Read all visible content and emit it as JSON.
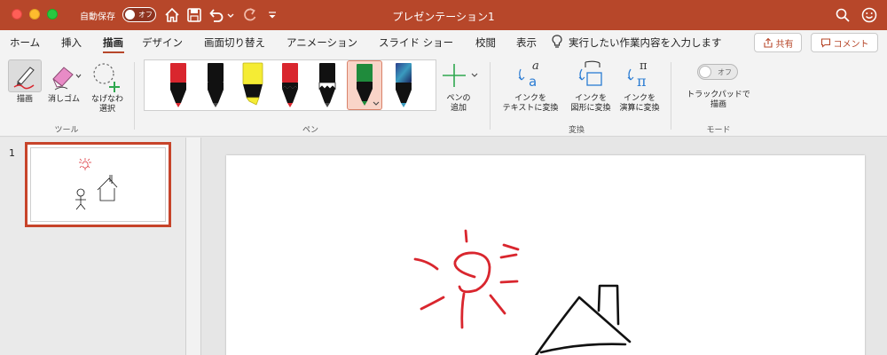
{
  "titlebar": {
    "autosave_label": "自動保存",
    "autosave_toggle_text": "オフ",
    "title": "プレゼンテーション1"
  },
  "menu": {
    "tabs": [
      "ホーム",
      "挿入",
      "描画",
      "デザイン",
      "画面切り替え",
      "アニメーション",
      "スライド ショー",
      "校閲",
      "表示"
    ],
    "active_tab": "描画",
    "tell_me": "実行したい作業内容を入力します",
    "share": "共有",
    "comment": "コメント"
  },
  "ribbon": {
    "tools_group": {
      "label": "ツール",
      "draw": "描画",
      "eraser": "消しゴム",
      "lasso_line1": "なげなわ",
      "lasso_line2": "選択"
    },
    "pens_group": {
      "label": "ペン",
      "pens": [
        {
          "name": "red-pen",
          "color": "#d9262e"
        },
        {
          "name": "black-pen",
          "color": "#111111"
        },
        {
          "name": "yellow-highlighter",
          "color": "#f5ec34"
        },
        {
          "name": "red-pencil",
          "color": "#d9262e"
        },
        {
          "name": "black-pencil",
          "color": "#111111"
        },
        {
          "name": "green-pen",
          "color": "#1f8b3c"
        },
        {
          "name": "galaxy-pen",
          "color": "#3a6fb0"
        }
      ],
      "selected_pen": "green-pen",
      "add_pen_line1": "ペンの",
      "add_pen_line2": "追加"
    },
    "convert_group": {
      "label": "変換",
      "ink_to_text_line1": "インクを",
      "ink_to_text_line2": "テキストに変換",
      "ink_to_shape_line1": "インクを",
      "ink_to_shape_line2": "図形に変換",
      "ink_to_math_line1": "インクを",
      "ink_to_math_line2": "演算に変換"
    },
    "mode_group": {
      "label": "モード",
      "toggle_text": "オフ",
      "trackpad_line1": "トラックパッドで",
      "trackpad_line2": "描画"
    }
  },
  "thumbnails": {
    "slide_number": "1"
  },
  "colors": {
    "accent": "#b7472a",
    "ink_red": "#d9262e",
    "ink_black": "#111111"
  }
}
